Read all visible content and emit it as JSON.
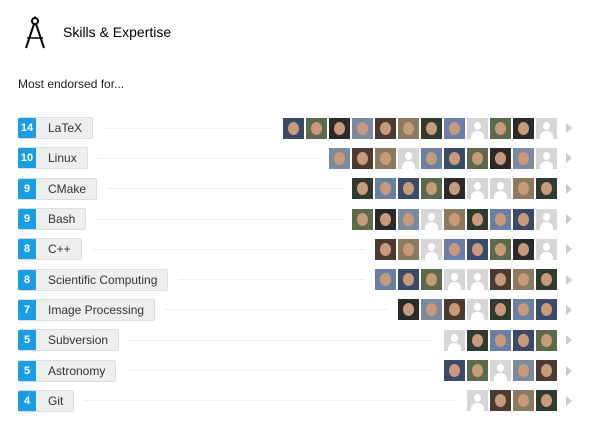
{
  "header": {
    "title": "Skills & Expertise",
    "icon": "compass-icon"
  },
  "subtitle": "Most endorsed for...",
  "skills": [
    {
      "count": "14",
      "name": "LaTeX",
      "avatars": [
        "photo",
        "photo",
        "photo",
        "photo",
        "photo",
        "photo",
        "photo",
        "photo",
        "default",
        "photo",
        "photo",
        "default"
      ]
    },
    {
      "count": "10",
      "name": "Linux",
      "avatars": [
        "photo",
        "photo",
        "photo",
        "default",
        "photo",
        "photo",
        "photo",
        "photo",
        "photo",
        "default"
      ]
    },
    {
      "count": "9",
      "name": "CMake",
      "avatars": [
        "photo",
        "photo",
        "photo",
        "photo",
        "photo",
        "default",
        "default",
        "photo",
        "photo"
      ]
    },
    {
      "count": "9",
      "name": "Bash",
      "avatars": [
        "photo",
        "photo",
        "photo",
        "default",
        "photo",
        "photo",
        "photo",
        "photo",
        "default"
      ]
    },
    {
      "count": "8",
      "name": "C++",
      "avatars": [
        "photo",
        "photo",
        "default",
        "photo",
        "photo",
        "photo",
        "photo",
        "default"
      ]
    },
    {
      "count": "8",
      "name": "Scientific Computing",
      "avatars": [
        "photo",
        "photo",
        "photo",
        "default",
        "default",
        "photo",
        "photo",
        "photo"
      ]
    },
    {
      "count": "7",
      "name": "Image Processing",
      "avatars": [
        "photo",
        "photo",
        "photo",
        "default",
        "photo",
        "photo",
        "photo"
      ]
    },
    {
      "count": "5",
      "name": "Subversion",
      "avatars": [
        "default",
        "photo",
        "photo",
        "photo",
        "photo"
      ]
    },
    {
      "count": "5",
      "name": "Astronomy",
      "avatars": [
        "photo",
        "photo",
        "default",
        "photo",
        "photo"
      ]
    },
    {
      "count": "4",
      "name": "Git",
      "avatars": [
        "default",
        "photo",
        "photo",
        "photo"
      ]
    }
  ]
}
